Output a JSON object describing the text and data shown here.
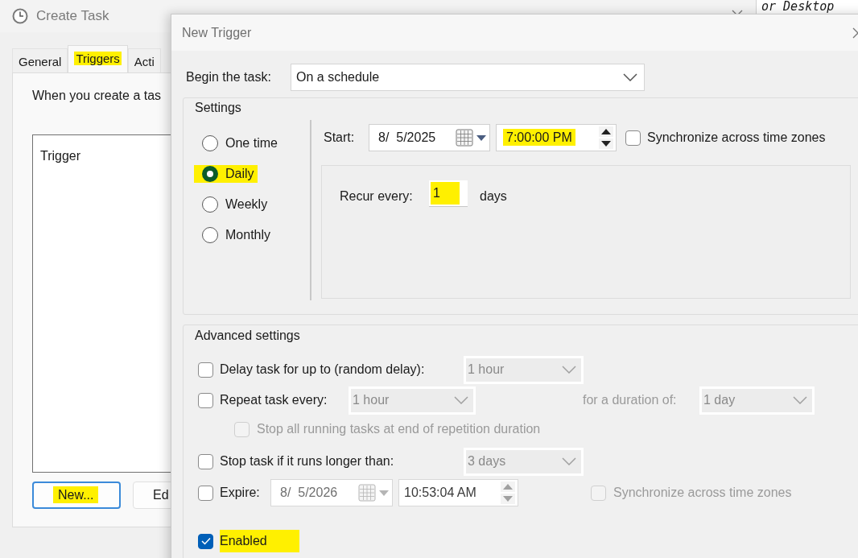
{
  "background": {
    "text": "or Desktop"
  },
  "create_task": {
    "title": "Create Task",
    "tabs": [
      {
        "label": "General",
        "selected": false,
        "highlighted": false
      },
      {
        "label": "Triggers",
        "selected": true,
        "highlighted": true
      },
      {
        "label": "Acti",
        "selected": false,
        "highlighted": false
      }
    ],
    "description": "When you create a tas",
    "list": {
      "column": "Trigger"
    },
    "buttons": [
      {
        "label": "New...",
        "focused": true,
        "highlighted": true
      },
      {
        "label": "Ed",
        "focused": false,
        "highlighted": false
      }
    ]
  },
  "new_trigger": {
    "title": "New Trigger",
    "begin_label": "Begin the task:",
    "begin_value": "On a schedule",
    "settings": {
      "title": "Settings",
      "schedule_options": [
        {
          "label": "One time",
          "selected": false,
          "highlighted": false
        },
        {
          "label": "Daily",
          "selected": true,
          "highlighted": true
        },
        {
          "label": "Weekly",
          "selected": false,
          "highlighted": false
        },
        {
          "label": "Monthly",
          "selected": false,
          "highlighted": false
        }
      ],
      "start_label": "Start:",
      "start_date": "8/  5/2025",
      "start_time": {
        "value": "7:00:00 PM",
        "highlighted": true
      },
      "sync": {
        "label": "Synchronize across time zones",
        "checked": false
      },
      "recur_label": "Recur every:",
      "recur_value": {
        "value": "1",
        "highlighted": true
      },
      "recur_unit": "days"
    },
    "advanced": {
      "title": "Advanced settings",
      "delay": {
        "label": "Delay task for up to (random delay):",
        "checked": false,
        "value": "1 hour"
      },
      "repeat": {
        "label": "Repeat task every:",
        "checked": false,
        "value": "1 hour",
        "duration_label": "for a duration of:",
        "duration_value": "1 day"
      },
      "stop_all": {
        "label": "Stop all running tasks at end of repetition duration",
        "checked": false,
        "disabled": true
      },
      "stop_longer": {
        "label": "Stop task if it runs longer than:",
        "checked": false,
        "value": "3 days"
      },
      "expire": {
        "label": "Expire:",
        "checked": false,
        "date": "8/  5/2026",
        "time": "10:53:04 AM",
        "sync": {
          "label": "Synchronize across time zones",
          "checked": false,
          "disabled": true
        }
      },
      "enabled": {
        "label": "Enabled",
        "checked": true,
        "highlighted": true
      }
    }
  }
}
